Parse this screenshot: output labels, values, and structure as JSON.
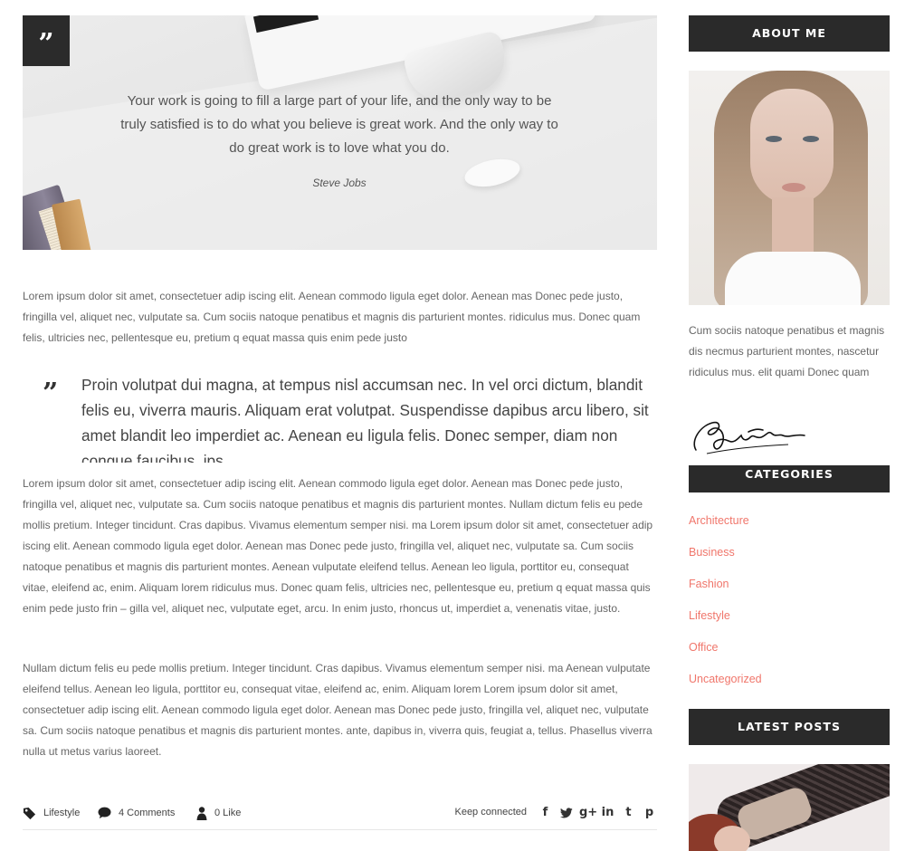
{
  "post": {
    "hero": {
      "quote_glyph": "”",
      "quote": "Your work is going to fill a large part of your life, and the only way to be truly satisfied is to do what you believe is great work. And the only way to do great work is to love what you do.",
      "author": "Steve Jobs"
    },
    "paragraph_1": "Lorem ipsum dolor sit amet, consectetuer adip iscing elit. Aenean commodo ligula eget dolor. Aenean mas Donec pede justo, fringilla vel, aliquet nec, vulputate sa. Cum sociis natoque penatibus et magnis dis parturient montes. ridiculus mus. Donec quam felis, ultricies nec, pellentesque eu, pretium q equat massa quis enim pede justo",
    "blockquote": {
      "glyph": "”",
      "text": "Proin volutpat dui magna, at tempus nisl accumsan nec. In vel orci dictum, blandit felis eu, viverra mauris. Aliquam erat volutpat. Suspendisse dapibus arcu libero, sit amet blandit leo imperdiet ac. Aenean eu ligula felis. Donec semper, diam non congue faucibus, ips"
    },
    "paragraph_2": "Lorem ipsum dolor sit amet, consectetuer adip iscing elit. Aenean commodo ligula eget dolor. Aenean mas Donec pede justo, fringilla vel, aliquet nec, vulputate sa. Cum sociis natoque penatibus et magnis dis parturient montes. Nullam dictum felis eu pede mollis pretium. Integer tincidunt. Cras dapibus. Vivamus elementum semper nisi. ma Lorem ipsum dolor sit amet, consectetuer adip iscing elit. Aenean commodo ligula eget dolor. Aenean mas Donec pede justo, fringilla vel, aliquet nec, vulputate sa. Cum sociis natoque penatibus et magnis dis parturient montes. Aenean vulputate eleifend tellus. Aenean leo ligula, porttitor eu, consequat vitae, eleifend ac, enim. Aliquam lorem ridiculus mus. Donec quam felis, ultricies nec, pellentesque eu, pretium q equat massa quis enim pede justo frin – gilla vel, aliquet nec, vulputate eget, arcu. In enim justo, rhoncus ut, imperdiet a, venenatis vitae, justo.",
    "paragraph_3": "Nullam dictum felis eu pede mollis pretium. Integer tincidunt. Cras dapibus. Vivamus elementum semper nisi. ma Aenean vulputate eleifend tellus. Aenean leo ligula, porttitor eu, consequat vitae, eleifend ac, enim. Aliquam lorem Lorem ipsum dolor sit amet, consectetuer adip iscing elit. Aenean commodo ligula eget dolor. Aenean mas Donec pede justo, fringilla vel, aliquet nec, vulputate sa. Cum sociis natoque penatibus et magnis dis parturient montes. ante, dapibus in, viverra quis, feugiat a, tellus. Phasellus viverra nulla ut metus varius laoreet.",
    "footer": {
      "category": "Lifestyle",
      "comments": "4 Comments",
      "likes": "0 Like",
      "keep_connected": "Keep connected",
      "socials": [
        {
          "icon": "facebook-icon",
          "glyph": "f"
        },
        {
          "icon": "twitter-icon",
          "glyph": "🐦"
        },
        {
          "icon": "google-plus-icon",
          "glyph": "g+"
        },
        {
          "icon": "linkedin-icon",
          "glyph": "in"
        },
        {
          "icon": "tumblr-icon",
          "glyph": "t"
        },
        {
          "icon": "pinterest-icon",
          "glyph": "p"
        }
      ]
    }
  },
  "sidebar": {
    "about": {
      "title": "ABOUT ME",
      "bio": "Cum sociis natoque penatibus et magnis dis necmus parturient montes, nascetur ridiculus mus. elit quami Donec quam"
    },
    "categories": {
      "title": "CATEGORIES",
      "items": [
        "Architecture",
        "Business",
        "Fashion",
        "Lifestyle",
        "Office",
        "Uncategorized"
      ]
    },
    "latest": {
      "title": "LATEST POSTS"
    }
  },
  "colors": {
    "accent": "#f0766b",
    "dark": "#2a2a2a",
    "text": "#666666"
  }
}
